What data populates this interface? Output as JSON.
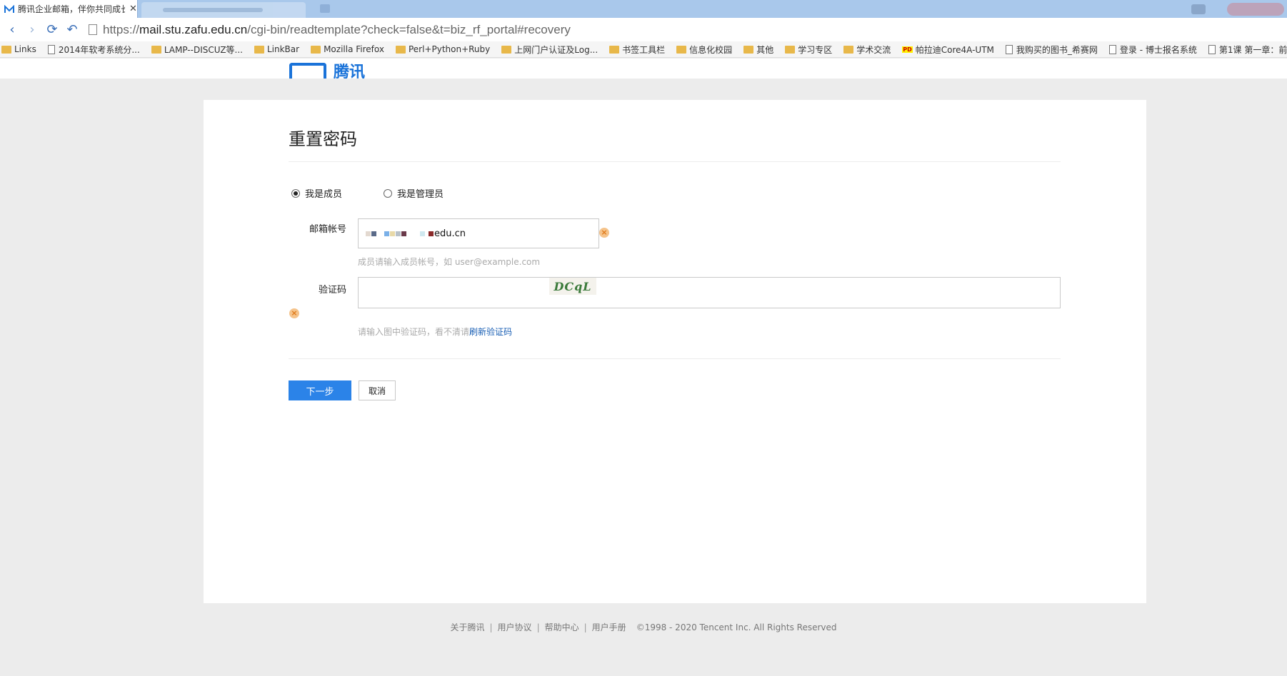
{
  "browser": {
    "tab_title": "腾讯企业邮箱，伴你共同成长",
    "tab_close": "✕",
    "url_scheme": "https://",
    "url_host": "mail.stu.zafu.edu.cn",
    "url_path": "/cgi-bin/readtemplate?check=false&t=biz_rf_portal#recovery",
    "bookmarks": [
      {
        "label": "Links",
        "icon": "folder-icon"
      },
      {
        "label": "2014年软考系统分...",
        "icon": "page-icon"
      },
      {
        "label": "LAMP--DISCUZ等...",
        "icon": "folder-icon"
      },
      {
        "label": "LinkBar",
        "icon": "folder-icon"
      },
      {
        "label": "Mozilla Firefox",
        "icon": "folder-icon"
      },
      {
        "label": "Perl+Python+Ruby",
        "icon": "folder-icon"
      },
      {
        "label": "上网门户认证及Log...",
        "icon": "folder-icon"
      },
      {
        "label": "书签工具栏",
        "icon": "folder-icon"
      },
      {
        "label": "信息化校园",
        "icon": "folder-icon"
      },
      {
        "label": "其他",
        "icon": "folder-icon"
      },
      {
        "label": "学习专区",
        "icon": "folder-icon"
      },
      {
        "label": "学术交流",
        "icon": "folder-icon"
      },
      {
        "label": "帕拉迪Core4A-UTM",
        "icon": "pd-icon"
      },
      {
        "label": "我购买的图书_希赛网",
        "icon": "page-icon"
      },
      {
        "label": "登录 - 博士报名系统",
        "icon": "page-icon"
      },
      {
        "label": "第1课 第一章：前",
        "icon": "page-icon"
      }
    ]
  },
  "header": {
    "logo_text": "腾讯"
  },
  "form": {
    "title": "重置密码",
    "role_member": "我是成员",
    "role_admin": "我是管理员",
    "selected_role": "member",
    "email_label": "邮箱帐号",
    "email_value_suffix": "edu.cn",
    "email_hint": "成员请输入成员帐号，如 user@example.com",
    "captcha_label": "验证码",
    "captcha_text": "DCqL",
    "captcha_hint": "请输入图中验证码，看不清请",
    "captcha_refresh": "刷新验证码",
    "error_glyph": "×",
    "next_button": "下一步",
    "cancel_button": "取消"
  },
  "footer": {
    "links": [
      "关于腾讯",
      "用户协议",
      "帮助中心",
      "用户手册"
    ],
    "separator": "|",
    "copyright": "©1998 - 2020 Tencent Inc. All Rights Reserved"
  },
  "colors": {
    "primary": "#2b83e8",
    "brand_blue": "#1a73d9",
    "error_orange": "#e07a1a",
    "link": "#1a5fb4"
  }
}
